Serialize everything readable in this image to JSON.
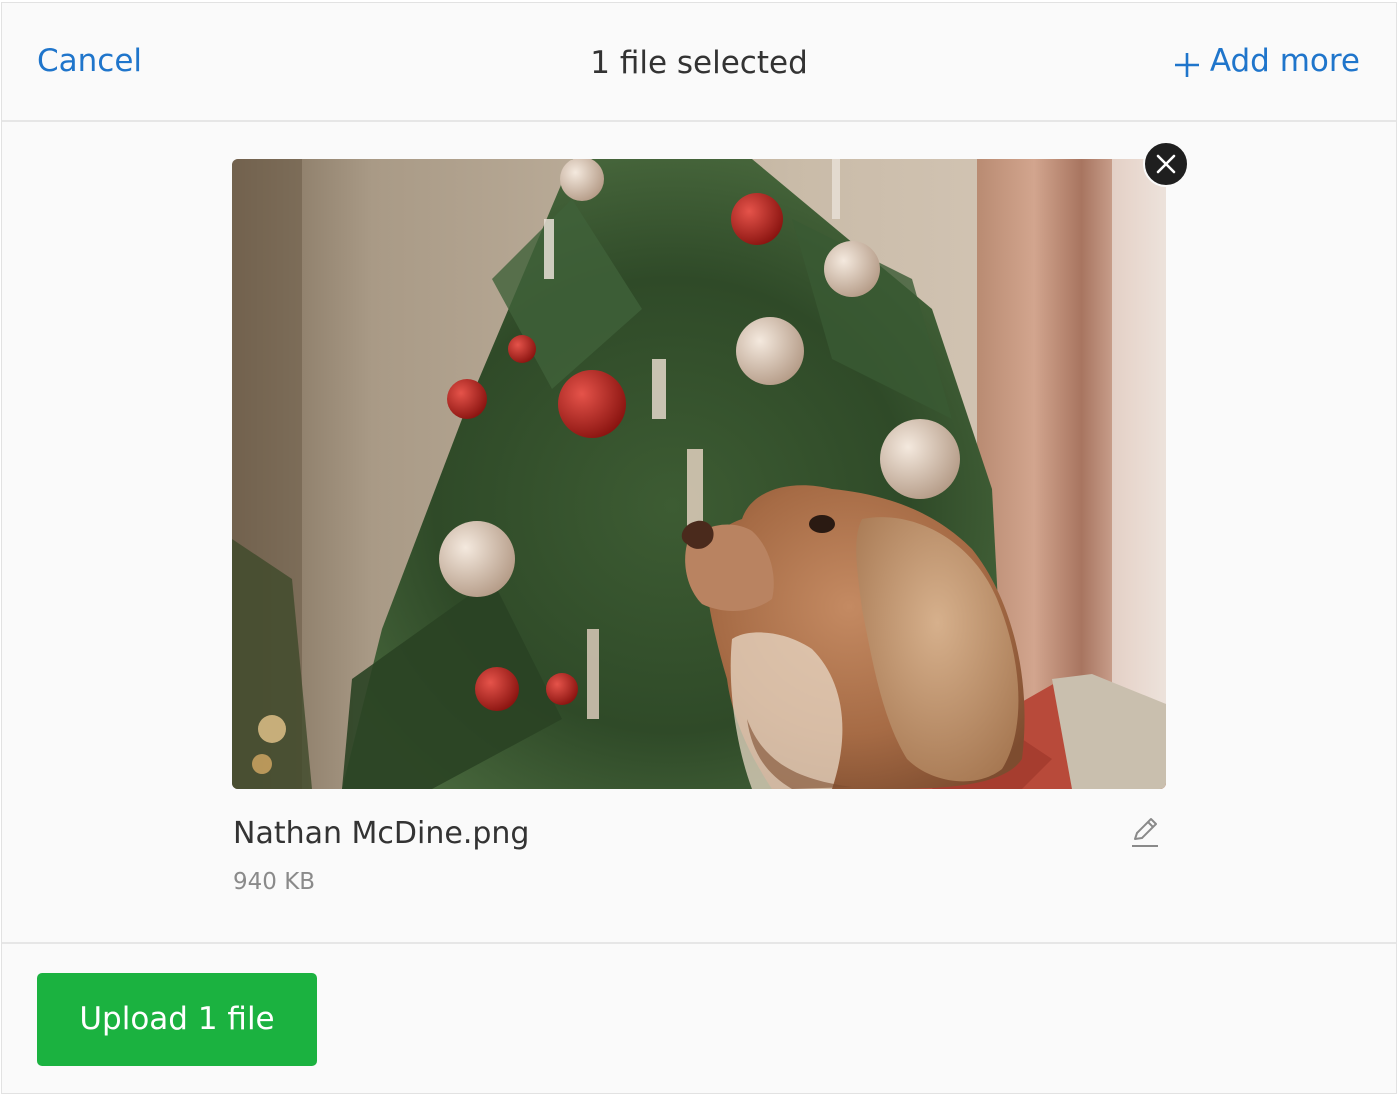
{
  "header": {
    "cancel_label": "Cancel",
    "title": "1 file selected",
    "add_more_label": "Add more"
  },
  "file": {
    "name": "Nathan McDine.png",
    "size": "940 KB"
  },
  "footer": {
    "upload_label": "Upload 1 file"
  },
  "icons": {
    "add": "plus-icon",
    "remove": "close-icon",
    "edit": "pencil-icon"
  },
  "colors": {
    "link": "#1f75cb",
    "primary_button": "#1bb240",
    "remove_button": "#1f1f1f"
  }
}
